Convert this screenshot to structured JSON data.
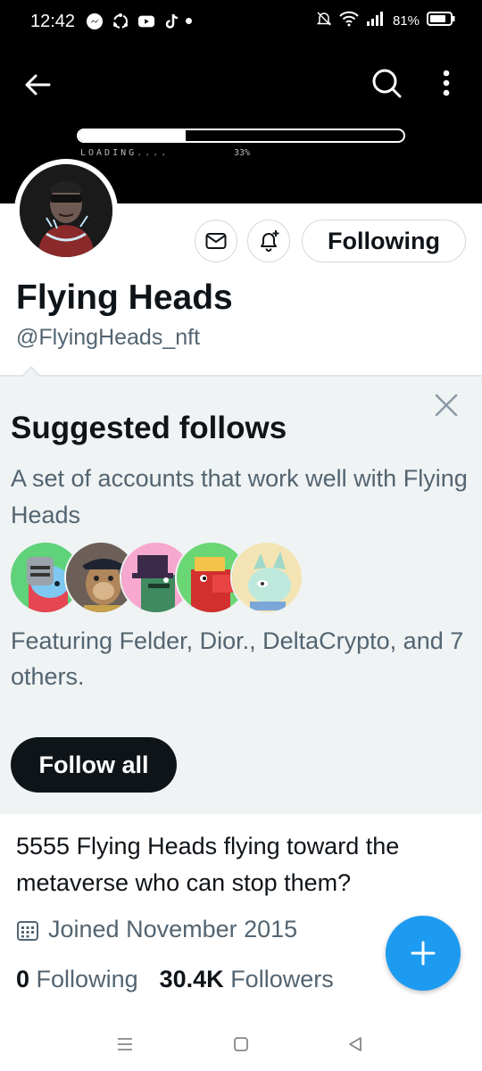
{
  "status_bar": {
    "time": "12:42",
    "battery": "81%",
    "left_icons": [
      "messenger-icon",
      "sync-icon",
      "youtube-icon",
      "tiktok-icon"
    ],
    "right_icons": [
      "mute-icon",
      "wifi-icon",
      "signal-icon",
      "battery-icon"
    ]
  },
  "banner": {
    "loading_label": "LOADING....",
    "loading_percent": "33%",
    "loading_progress": 0.33
  },
  "profile": {
    "display_name": "Flying Heads",
    "handle": "@FlyingHeads_nft",
    "following_button": "Following",
    "bio": "5555 Flying Heads flying toward the metaverse who can stop them?",
    "joined": "Joined November 2015",
    "following_count": "0",
    "following_label": "Following",
    "followers_count": "30.4K",
    "followers_label": "Followers"
  },
  "suggested": {
    "title": "Suggested follows",
    "subtitle": "A set of accounts that work well with Flying Heads",
    "featuring": "Featuring Felder, Dior., DeltaCrypto, and 7 others.",
    "follow_all": "Follow all",
    "avatar_colors": [
      "#5fd27a",
      "#6b5f57",
      "#f7a8cf",
      "#6ad774",
      "#f4e4b4"
    ]
  },
  "colors": {
    "accent": "#1d9bf0",
    "text": "#0f1419",
    "muted": "#536471",
    "panel": "#eff3f4"
  }
}
